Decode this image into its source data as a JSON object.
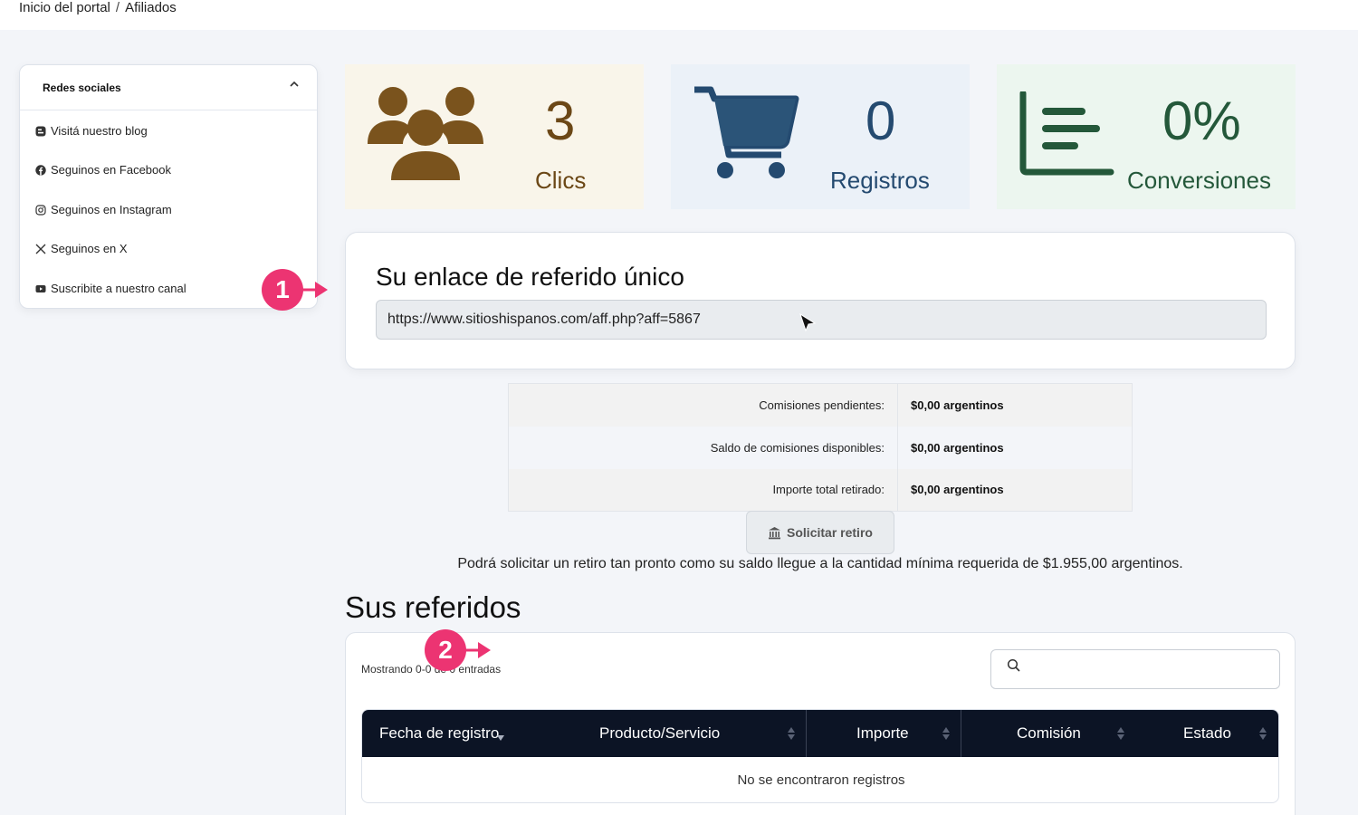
{
  "breadcrumb": {
    "home": "Inicio del portal",
    "separator": "/",
    "current": "Afiliados"
  },
  "sidebar": {
    "title": "Redes sociales",
    "items": [
      {
        "label": "Visitá nuestro blog",
        "icon": "blogger-icon"
      },
      {
        "label": "Seguinos en Facebook",
        "icon": "facebook-icon"
      },
      {
        "label": "Seguinos en Instagram",
        "icon": "instagram-icon"
      },
      {
        "label": "Seguinos en X",
        "icon": "x-icon"
      },
      {
        "label": "Suscribite a nuestro canal",
        "icon": "youtube-icon"
      }
    ]
  },
  "stats": {
    "clics": {
      "value": "3",
      "label": "Clics",
      "icon": "users-icon",
      "color": "#6b4716"
    },
    "registros": {
      "value": "0",
      "label": "Registros",
      "icon": "cart-icon",
      "color": "#244a70"
    },
    "conversiones": {
      "value": "0%",
      "label": "Conversiones",
      "icon": "bar-chart-icon",
      "color": "#24583a"
    }
  },
  "referral": {
    "title": "Su enlace de referido único",
    "link": "https://www.sitioshispanos.com/aff.php?aff=5867"
  },
  "commissions": [
    {
      "label": "Comisiones pendientes:",
      "value": "$0,00 argentinos"
    },
    {
      "label": "Saldo de comisiones disponibles:",
      "value": "$0,00 argentinos"
    },
    {
      "label": "Importe total retirado:",
      "value": "$0,00 argentinos"
    }
  ],
  "withdraw": {
    "button": "Solicitar retiro",
    "note": "Podrá solicitar un retiro tan pronto como su saldo llegue a la cantidad mínima requerida de $1.955,00 argentinos."
  },
  "referrals": {
    "title": "Sus referidos",
    "showing": "Mostrando 0-0 de 0 entradas",
    "search_value": "",
    "columns": [
      "Fecha de registro",
      "Producto/Servicio",
      "Importe",
      "Comisión",
      "Estado"
    ],
    "empty": "No se encontraron registros"
  },
  "annotations": {
    "badge1": "1",
    "badge2": "2",
    "color": "#ec3472"
  }
}
